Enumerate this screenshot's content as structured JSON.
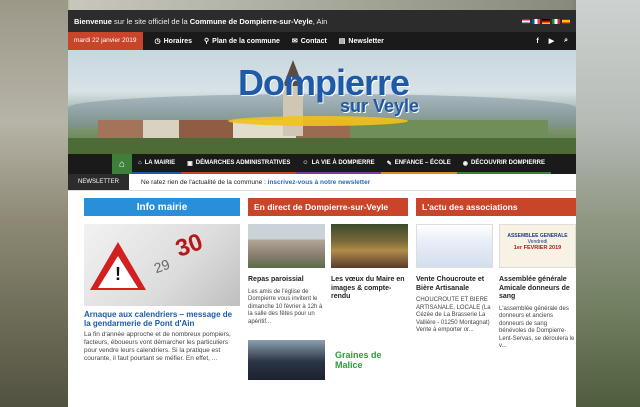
{
  "topbar": {
    "prefix": "Bienvenue",
    "middle": " sur le site officiel de la ",
    "commune": "Commune de Dompierre-sur-Veyle",
    "suffix": ", Ain"
  },
  "flags": [
    "#b22234",
    "#0055a4",
    "#000000",
    "#009246",
    "#c60b1e"
  ],
  "nav1": {
    "date": "mardi 22 janvier 2019",
    "items": [
      {
        "icon": "clock-icon",
        "label": "Horaires"
      },
      {
        "icon": "map-pin-icon",
        "label": "Plan de la commune"
      },
      {
        "icon": "envelope-icon",
        "label": "Contact"
      },
      {
        "icon": "newspaper-icon",
        "label": "Newsletter"
      }
    ]
  },
  "banner": {
    "logo_main": "Dompierre",
    "logo_sub": "sur Veyle"
  },
  "nav2": {
    "items": [
      {
        "icon": "bank-icon",
        "label": "LA MAIRIE",
        "color": "#1e5aa8"
      },
      {
        "icon": "file-icon",
        "label": "DÉMARCHES ADMINISTRATIVES",
        "color": "#c9452a"
      },
      {
        "icon": "people-icon",
        "label": "LA VIE À DOMPIERRE",
        "color": "#7a3ea0"
      },
      {
        "icon": "child-icon",
        "label": "ENFANCE – ÉCOLE",
        "color": "#d98b1f"
      },
      {
        "icon": "camera-icon",
        "label": "DÉCOUVRIR DOMPIERRE",
        "color": "#3e7f3a"
      }
    ]
  },
  "newsbar": {
    "label": "NEWSLETTER",
    "text": "Ne ratez rien de l'actualité de la commune : ",
    "link": "inscrivez-vous à notre newsletter"
  },
  "col1": {
    "title": "Info mairie",
    "color": "#2a8fd9",
    "art_title": "Arnaque aux calendriers – message de la gendarmerie de Pont d'Ain",
    "art_text": "La fin d'année approche et de nombreux pompiers, facteurs, éboueurs vont démarcher les particuliers pour vendre leurs calendriers. Si la pratique est courante, il faut pourtant se méfier. En effet, ..."
  },
  "col2": {
    "title": "En direct de Dompierre-sur-Veyle",
    "color": "#c9452a",
    "articles": [
      {
        "title": "Repas paroissial",
        "text": "Les amis de l'église de Dompierre vous invitent le dimanche 10 février à 12h à la salle des fêtes pour un apéritif..."
      },
      {
        "title": "Les vœux du Maire en images & compte-rendu",
        "text": ""
      }
    ],
    "logo_text": "Graines de Malice"
  },
  "col3": {
    "title": "L'actu des associations",
    "color": "#c9452a",
    "articles": [
      {
        "title": "Vente Choucroute et Bière Artisanale",
        "text": "CHOUCROUTE ET BIERE ARTISANALE, LOCALE (La Cézée de La Brasserie La Vallière - 01250 Montagnat) Vente à emporter or..."
      },
      {
        "title": "Assemblée générale Amicale donneurs de sang",
        "text": "L'assemblée générale des donneurs et anciens donneurs de sang bénévoles de Dompierre-Lent-Servas, se déroulera le v..."
      }
    ],
    "poster1_head": "ASSEMBLEE GENERALE",
    "poster1_sub": "Vendredi",
    "poster1_date": "1er FEVRIER 2019"
  }
}
